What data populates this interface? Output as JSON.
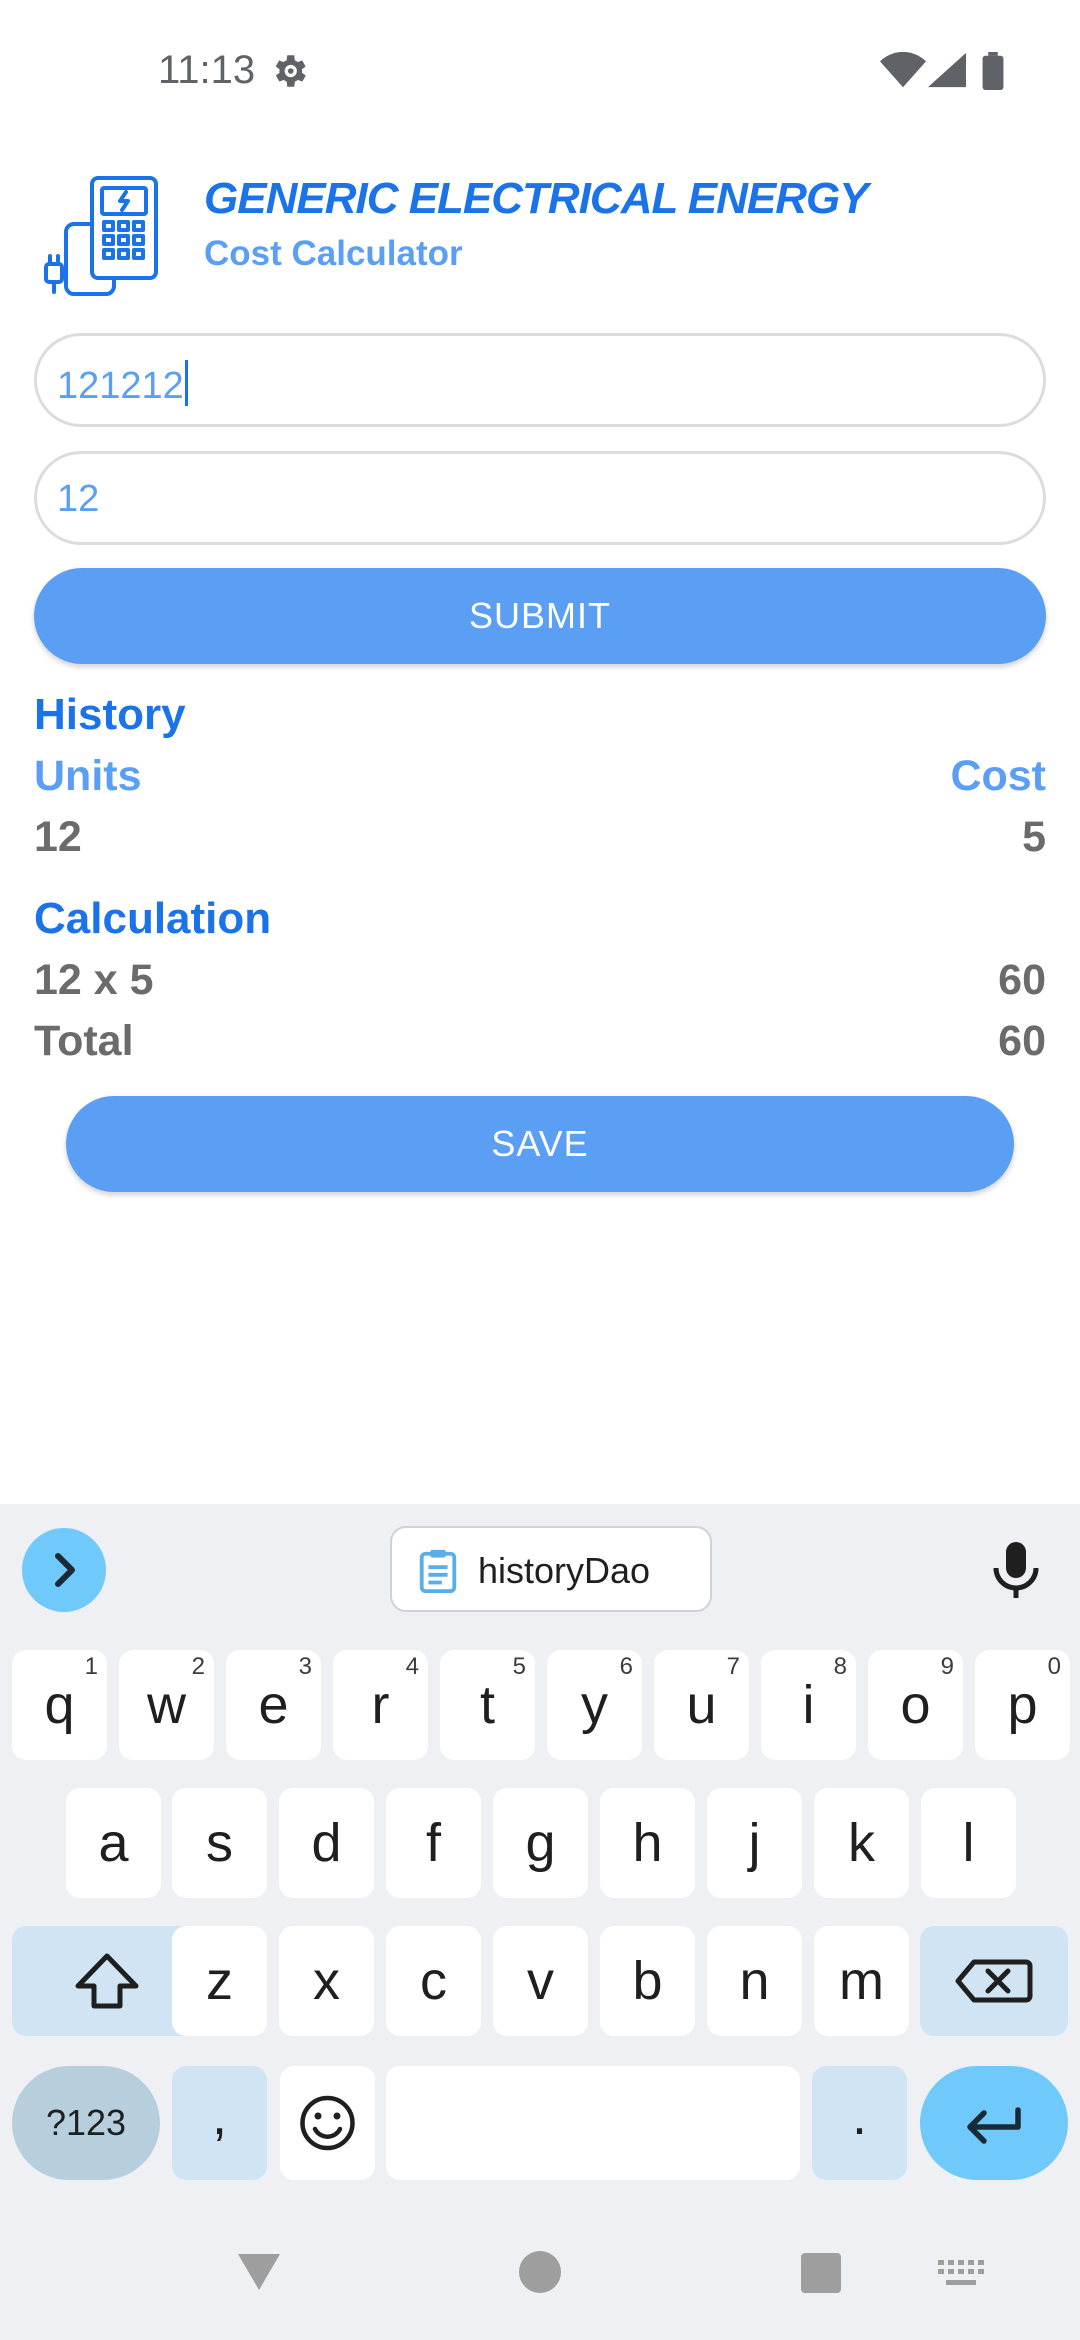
{
  "status_bar": {
    "time": "11:13"
  },
  "header": {
    "title": "GENERIC ELECTRICAL ENERGY",
    "subtitle": "Cost Calculator"
  },
  "form": {
    "units_value": "121212",
    "cost_value": "12",
    "submit_label": "SUBMIT"
  },
  "history": {
    "heading": "History",
    "units_header": "Units",
    "cost_header": "Cost",
    "row": {
      "units": "12",
      "cost": "5"
    }
  },
  "calculation": {
    "heading": "Calculation",
    "expression": "12 x 5",
    "expression_result": "60",
    "total_label": "Total",
    "total_value": "60",
    "save_label": "SAVE"
  },
  "keyboard": {
    "suggestion": "historyDao",
    "row1": [
      {
        "key": "q",
        "hint": "1"
      },
      {
        "key": "w",
        "hint": "2"
      },
      {
        "key": "e",
        "hint": "3"
      },
      {
        "key": "r",
        "hint": "4"
      },
      {
        "key": "t",
        "hint": "5"
      },
      {
        "key": "y",
        "hint": "6"
      },
      {
        "key": "u",
        "hint": "7"
      },
      {
        "key": "i",
        "hint": "8"
      },
      {
        "key": "o",
        "hint": "9"
      },
      {
        "key": "p",
        "hint": "0"
      }
    ],
    "row2": [
      "a",
      "s",
      "d",
      "f",
      "g",
      "h",
      "j",
      "k",
      "l"
    ],
    "row3": [
      "z",
      "x",
      "c",
      "v",
      "b",
      "n",
      "m"
    ],
    "symbols_label": "?123",
    "comma": ",",
    "period": "."
  },
  "colors": {
    "accent_dark": "#1a73e8",
    "accent_light": "#5b9ff5",
    "keyboard_bg": "#eef0f4",
    "enter_key": "#6fc9fa"
  },
  "icons": [
    "gear-icon",
    "wifi-icon",
    "signal-icon",
    "battery-icon",
    "calculator-plug-icon",
    "chevron-right-icon",
    "clipboard-icon",
    "microphone-icon",
    "shift-icon",
    "backspace-icon",
    "emoji-icon",
    "enter-icon",
    "back-icon",
    "home-icon",
    "recents-icon",
    "keyboard-icon"
  ]
}
